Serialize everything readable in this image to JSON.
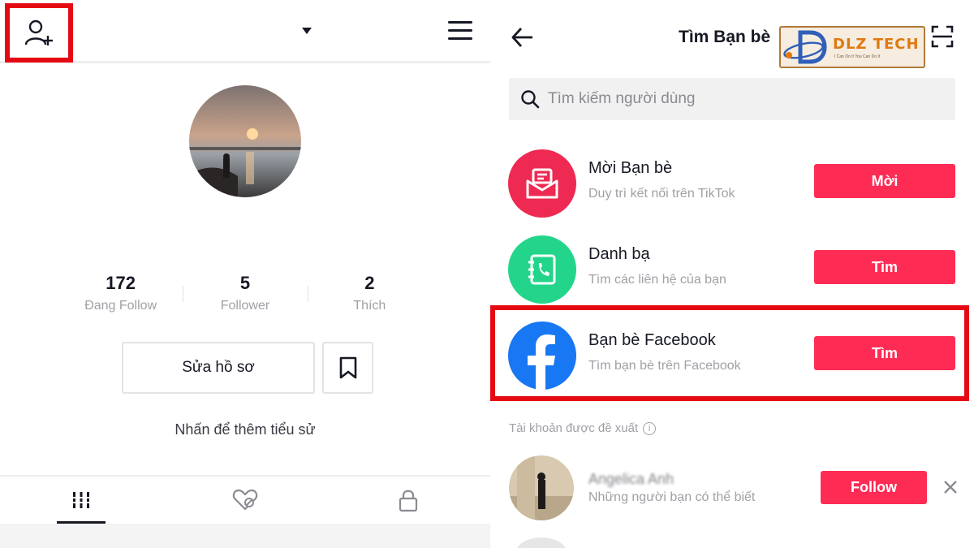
{
  "colors": {
    "accent": "#fe2c55",
    "highlight_frame": "#e50914",
    "text_primary": "#161823",
    "text_secondary": "#a0a0a6",
    "invite_icon_bg": "#ee2a52",
    "contacts_icon_bg": "#22d58a",
    "facebook_blue": "#1877f2"
  },
  "left": {
    "icons": {
      "add_user": "person-add-icon",
      "menu": "hamburger-menu-icon",
      "caret": "chevron-down-icon"
    },
    "stats": [
      {
        "value": "172",
        "label": "Đang Follow"
      },
      {
        "value": "5",
        "label": "Follower"
      },
      {
        "value": "2",
        "label": "Thích"
      }
    ],
    "edit_profile_label": "Sửa hồ sơ",
    "bio_prompt": "Nhấn để thêm tiểu sử",
    "tabs": [
      {
        "icon": "video-grid-icon",
        "active": true
      },
      {
        "icon": "liked-heart-icon",
        "active": false
      },
      {
        "icon": "lock-icon",
        "active": false
      }
    ]
  },
  "right": {
    "title": "Tìm Bạn bè",
    "logo": {
      "text": "DLZ TECH",
      "tagline": "I Can Do It You Can Do It"
    },
    "search": {
      "placeholder": "Tìm kiếm người dùng"
    },
    "rows": [
      {
        "title": "Mời Bạn bè",
        "subtitle": "Duy trì kết nối trên TikTok",
        "button": "Mời",
        "icon": "invite-envelope-icon"
      },
      {
        "title": "Danh bạ",
        "subtitle": "Tìm các liên hệ của bạn",
        "button": "Tìm",
        "icon": "contacts-book-icon"
      },
      {
        "title": "Bạn bè Facebook",
        "subtitle": "Tìm bạn bè trên Facebook",
        "button": "Tìm",
        "icon": "facebook-icon"
      }
    ],
    "suggested_label": "Tài khoản được đề xuất",
    "suggestion": {
      "name": "Angelica Anh",
      "subtitle": "Những người bạn có thể biết",
      "button": "Follow"
    }
  }
}
